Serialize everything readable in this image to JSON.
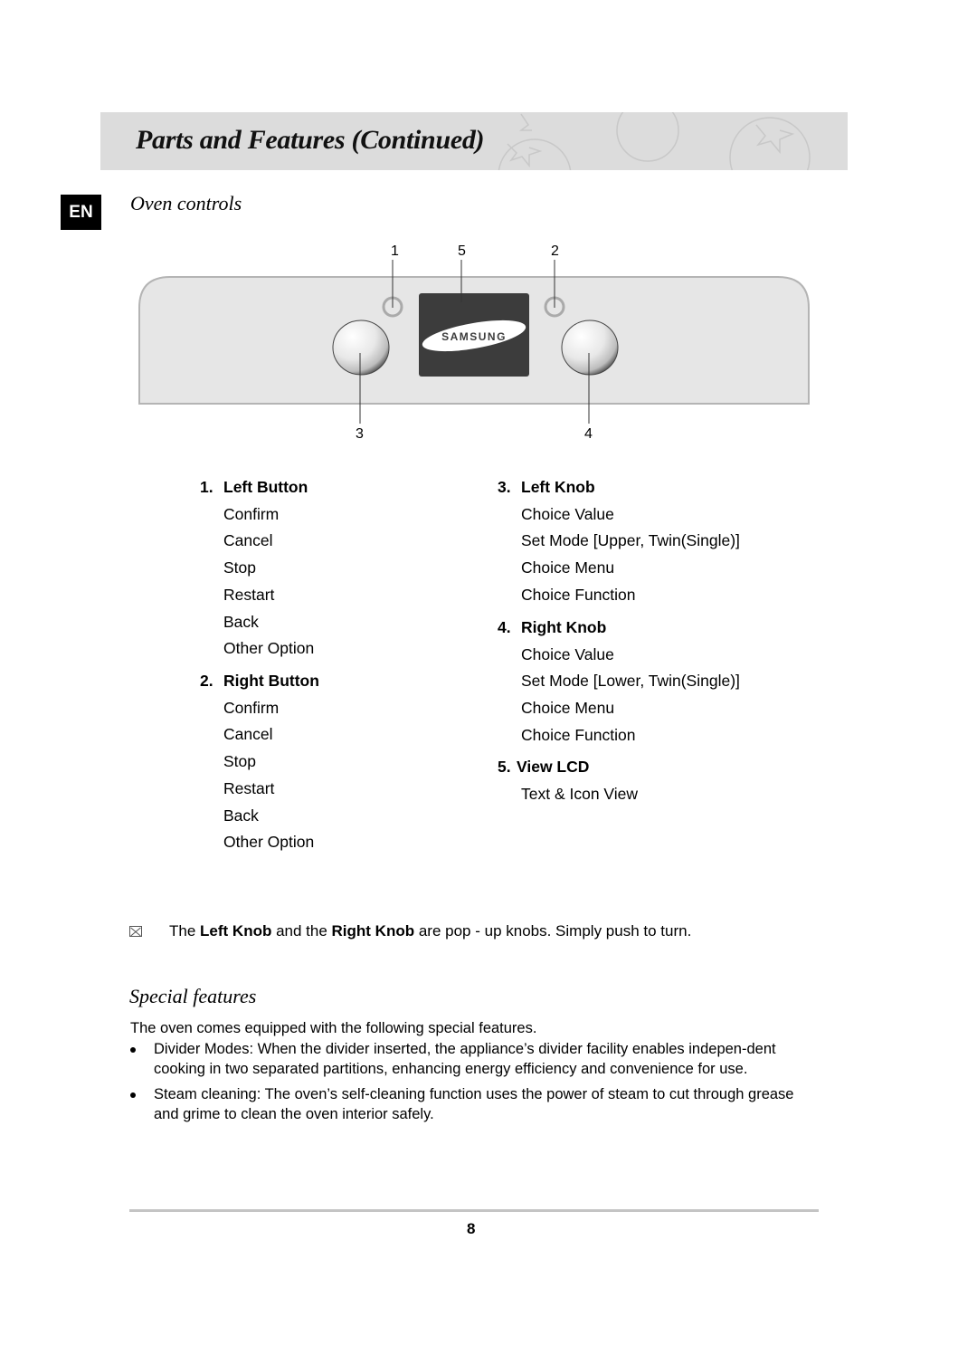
{
  "header": {
    "title": "Parts and Features (Continued)",
    "band_color": "#dcdcdc"
  },
  "language_badge": "EN",
  "oven_controls": {
    "title": "Oven controls",
    "diagram": {
      "callouts": [
        "1",
        "5",
        "2",
        "3",
        "4"
      ],
      "brand_logo": "SAMSUNG",
      "panel_color": "#e6e6e6",
      "lcd_color": "#3c3c3c"
    },
    "left_column": [
      {
        "number": "1.",
        "label": "Left Button",
        "items": [
          "Confirm",
          "Cancel",
          "Stop",
          "Restart",
          "Back",
          "Other Option"
        ]
      },
      {
        "number": "2.",
        "label": "Right Button",
        "items": [
          "Confirm",
          "Cancel",
          "Stop",
          "Restart",
          "Back",
          "Other Option"
        ]
      }
    ],
    "right_column": [
      {
        "number": "3.",
        "label": "Left Knob",
        "items": [
          "Choice Value",
          "Set Mode [Upper, Twin(Single)]",
          "Choice Menu",
          "Choice Function"
        ]
      },
      {
        "number": "4.",
        "label": "Right Knob",
        "items": [
          "Choice Value",
          "Set Mode [Lower, Twin(Single)]",
          "Choice Menu",
          "Choice Function"
        ]
      },
      {
        "number": "5.",
        "label": "View LCD",
        "items": [
          "Text & Icon View"
        ]
      }
    ]
  },
  "note": {
    "icon": "note-icon",
    "prefix": "The ",
    "bold1": "Left Knob",
    "middle": " and the ",
    "bold2": "Right Knob",
    "suffix": " are pop - up knobs. Simply push to turn."
  },
  "special_features": {
    "title": "Special features",
    "intro": "The oven comes equipped with the following special features.",
    "bullets": [
      "Divider Modes: When the divider inserted, the appliance’s divider facility enables indepen-dent cooking in two separated partitions, enhancing energy efficiency and convenience for use.",
      "Steam cleaning: The oven’s self-cleaning function uses the power of steam to cut through grease and grime to clean the oven interior safely."
    ]
  },
  "footer": {
    "page_number": "8"
  }
}
